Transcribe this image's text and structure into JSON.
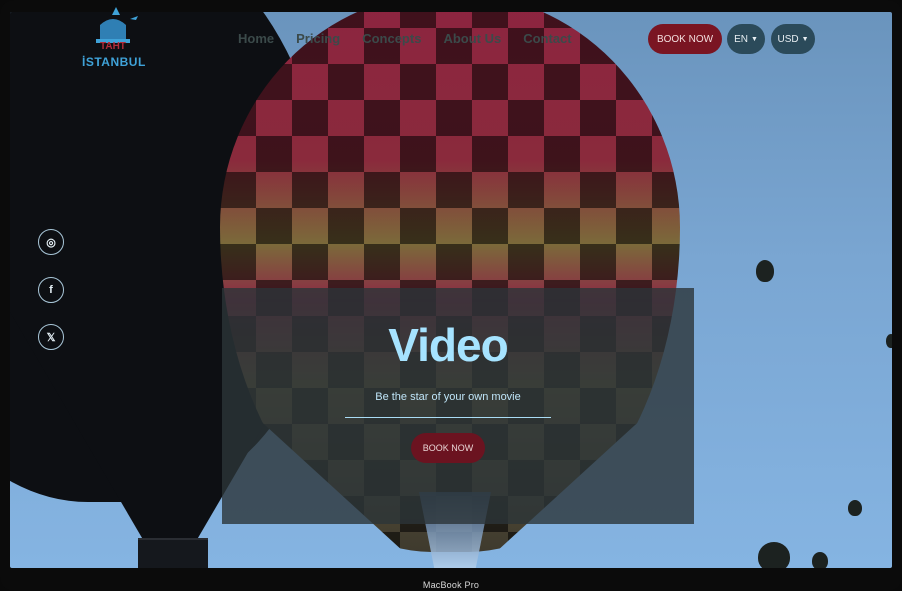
{
  "brand": {
    "line1": "TAHT",
    "line2": "İSTANBUL"
  },
  "nav": [
    "Home",
    "Pricing",
    "Concepts",
    "About Us",
    "Contact"
  ],
  "header": {
    "book_label": "BOOK NOW",
    "language": "EN",
    "currency": "USD"
  },
  "social": [
    {
      "icon": "instagram-icon",
      "glyph": "◎"
    },
    {
      "icon": "facebook-icon",
      "glyph": "f"
    },
    {
      "icon": "x-icon",
      "glyph": "𝕏"
    }
  ],
  "hero": {
    "title": "Video",
    "subtitle": "Be the star of your own movie",
    "button_label": "BOOK NOW"
  },
  "device_label": "MacBook Pro",
  "colors": {
    "accent": "#7a1522",
    "title": "#a6e3ff",
    "pill": "#2b4a5a"
  }
}
